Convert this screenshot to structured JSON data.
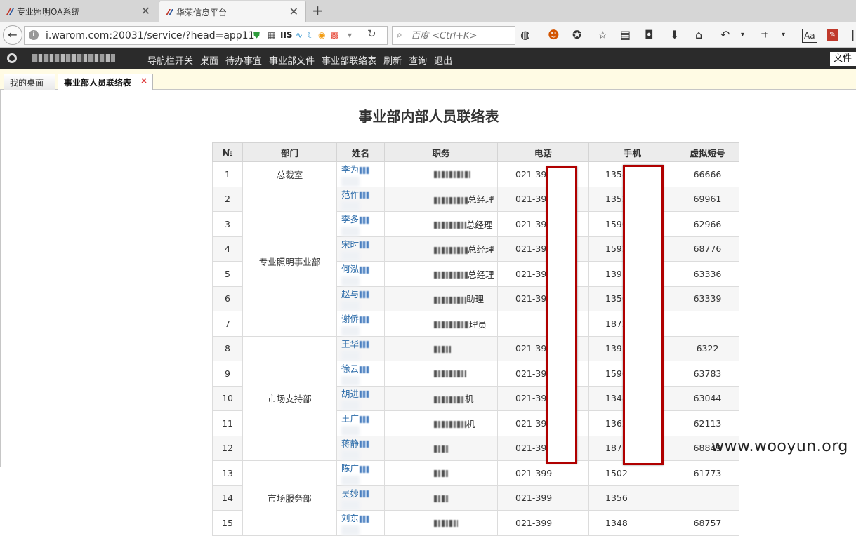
{
  "browser": {
    "tabs": [
      {
        "label": "专业照明OA系统",
        "active": false
      },
      {
        "label": "华荣信息平台",
        "active": true
      }
    ],
    "url": "i.warom.com:20031/service/?head=app11",
    "url_extensions": "IIS",
    "search_placeholder": "百度 <Ctrl+K>"
  },
  "app": {
    "menu": [
      "导航栏开关",
      "桌面",
      "待办事宜",
      "事业部文件",
      "事业部联络表",
      "刷新",
      "查询",
      "退出"
    ],
    "file_menu": "文件"
  },
  "page_tabs": {
    "desktop": "我的桌面",
    "contacts": "事业部人员联络表",
    "close": "×"
  },
  "page_title": "事业部内部人员联络表",
  "table": {
    "headers": [
      "№",
      "部门",
      "姓名",
      "职务",
      "电话",
      "手机",
      "虚拟短号"
    ],
    "departments": {
      "d1": "总裁室",
      "d2": "专业照明事业部",
      "d3": "市场支持部",
      "d4": "市场服务部"
    },
    "rows": [
      {
        "no": "1",
        "name": "李为",
        "title": "",
        "phone": "021-399",
        "mobile": "1358",
        "short": "66666"
      },
      {
        "no": "2",
        "name": "范作",
        "title": "总经理",
        "phone": "021-399",
        "mobile": "1352",
        "short": "69961"
      },
      {
        "no": "3",
        "name": "李多",
        "title": "总经理",
        "phone": "021-399",
        "mobile": "1590",
        "short": "62966"
      },
      {
        "no": "4",
        "name": "宋时",
        "title": "总经理",
        "phone": "021-399",
        "mobile": "1592",
        "short": "68776"
      },
      {
        "no": "5",
        "name": "何泓",
        "title": "总经理",
        "phone": "021-399",
        "mobile": "1391",
        "short": "63336"
      },
      {
        "no": "6",
        "name": "赵与",
        "title": "助理",
        "phone": "021-399",
        "mobile": "1350",
        "short": "63339"
      },
      {
        "no": "7",
        "name": "谢侨",
        "title": "理员",
        "phone": "",
        "mobile": "1872",
        "short": ""
      },
      {
        "no": "8",
        "name": "王华",
        "title": "",
        "phone": "021-399",
        "mobile": "1391",
        "short": "6322"
      },
      {
        "no": "9",
        "name": "徐云",
        "title": "",
        "phone": "021-399",
        "mobile": "1590",
        "short": "63783"
      },
      {
        "no": "10",
        "name": "胡进",
        "title": "机",
        "phone": "021-399",
        "mobile": "1348",
        "short": "63044"
      },
      {
        "no": "11",
        "name": "王广",
        "title": "机",
        "phone": "021-399",
        "mobile": "1362",
        "short": "62113"
      },
      {
        "no": "12",
        "name": "蒋静",
        "title": "",
        "phone": "021-399",
        "mobile": "1871",
        "short": "68849"
      },
      {
        "no": "13",
        "name": "陈广",
        "title": "",
        "phone": "021-399",
        "mobile": "1502",
        "short": "61773"
      },
      {
        "no": "14",
        "name": "吴妙",
        "title": "",
        "phone": "021-399",
        "mobile": "1356",
        "short": ""
      },
      {
        "no": "15",
        "name": "刘东",
        "title": "",
        "phone": "021-399",
        "mobile": "1348",
        "short": "68757"
      }
    ]
  },
  "watermark": "www.wooyun.org",
  "colors": {
    "app_header": "#2b2b2b",
    "tab_bar": "#fffbe4",
    "redaction_border": "#b00000",
    "name_link": "#2a6aa8"
  }
}
